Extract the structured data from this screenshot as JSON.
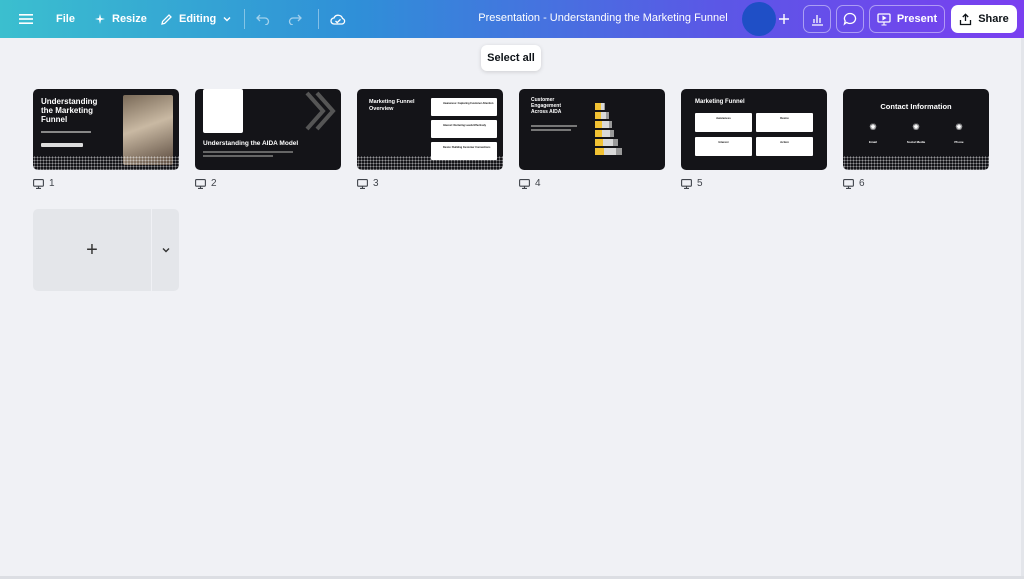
{
  "topbar": {
    "file_label": "File",
    "resize_label": "Resize",
    "editing_label": "Editing",
    "doc_title": "Presentation - Understanding the Marketing Funnel",
    "present_label": "Present",
    "share_label": "Share"
  },
  "tooltip": {
    "text": "Select all"
  },
  "slides": [
    {
      "number": "1",
      "title": "Understanding the Marketing Funnel"
    },
    {
      "number": "2",
      "title": "Understanding the AIDA Model"
    },
    {
      "number": "3",
      "title": "Marketing Funnel Overview"
    },
    {
      "number": "4",
      "title": "Customer Engagement Across AIDA"
    },
    {
      "number": "5",
      "title": "Marketing Funnel"
    },
    {
      "number": "6",
      "title": "Contact Information"
    }
  ],
  "slide3_items": [
    "Awareness: Capturing Customer Attention",
    "Interest: Nurturing Leads Effectively",
    "Desire: Building Customer Connections"
  ],
  "slide5_boxes": [
    "Awareness",
    "Desire",
    "Interest",
    "Action"
  ],
  "slide6_columns": [
    "Email",
    "Social Media",
    "Phone"
  ],
  "slide4_chart": {
    "type": "bar",
    "series": [
      {
        "name": "",
        "color": "#f2c233"
      },
      {
        "name": "",
        "color": "#d9d9d9"
      },
      {
        "name": "",
        "color": "#9a9a9a"
      }
    ]
  },
  "add_slide": {
    "plus": "+"
  },
  "colors": {
    "accent_gradient_start": "#3bbfcf",
    "accent_gradient_end": "#7a3ff0",
    "canvas_bg": "#f0f1f5"
  }
}
